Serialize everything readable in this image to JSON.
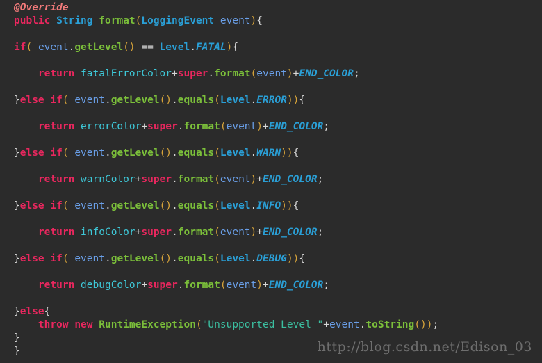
{
  "editor": {
    "background_color": "#2b2b2b",
    "language": "Java",
    "palette": {
      "keyword": "#e8275e",
      "annotation": "#f07a7a",
      "type": "#2a9fd6",
      "constant": "#2a9fd6",
      "method": "#7bbf3a",
      "variable": "#6a9fe8",
      "field": "#3ec8d8",
      "string": "#3bbfa0",
      "paren": "#d6a33a",
      "punctuation": "#d8d8d8"
    }
  },
  "code": {
    "lines": [
      {
        "indent": 0,
        "tokens": [
          {
            "t": "@Override",
            "c": "ann"
          }
        ]
      },
      {
        "indent": 0,
        "tokens": [
          {
            "t": "public",
            "c": "kw"
          },
          {
            "t": " ",
            "c": "pun"
          },
          {
            "t": "String",
            "c": "type"
          },
          {
            "t": " ",
            "c": "pun"
          },
          {
            "t": "format",
            "c": "mth"
          },
          {
            "t": "(",
            "c": "par"
          },
          {
            "t": "LoggingEvent",
            "c": "type"
          },
          {
            "t": " ",
            "c": "pun"
          },
          {
            "t": "event",
            "c": "var"
          },
          {
            "t": ")",
            "c": "par"
          },
          {
            "t": "{",
            "c": "brc"
          }
        ]
      },
      {
        "blank": true
      },
      {
        "indent": 0,
        "tokens": [
          {
            "t": "if",
            "c": "kw"
          },
          {
            "t": "(",
            "c": "par"
          },
          {
            "t": " ",
            "c": "pun"
          },
          {
            "t": "event",
            "c": "var"
          },
          {
            "t": ".",
            "c": "pun"
          },
          {
            "t": "getLevel",
            "c": "mth"
          },
          {
            "t": "()",
            "c": "par"
          },
          {
            "t": " == ",
            "c": "pun"
          },
          {
            "t": "Level",
            "c": "type"
          },
          {
            "t": ".",
            "c": "pun"
          },
          {
            "t": "FATAL",
            "c": "const"
          },
          {
            "t": ")",
            "c": "par"
          },
          {
            "t": "{",
            "c": "brc"
          }
        ]
      },
      {
        "blank": true
      },
      {
        "indent": 1,
        "tokens": [
          {
            "t": "return",
            "c": "kw"
          },
          {
            "t": " ",
            "c": "pun"
          },
          {
            "t": "fatalErrorColor",
            "c": "fld"
          },
          {
            "t": "+",
            "c": "pun"
          },
          {
            "t": "super",
            "c": "kw"
          },
          {
            "t": ".",
            "c": "pun"
          },
          {
            "t": "format",
            "c": "mth"
          },
          {
            "t": "(",
            "c": "par"
          },
          {
            "t": "event",
            "c": "var"
          },
          {
            "t": ")",
            "c": "par"
          },
          {
            "t": "+",
            "c": "pun"
          },
          {
            "t": "END_COLOR",
            "c": "const"
          },
          {
            "t": ";",
            "c": "pun"
          }
        ]
      },
      {
        "blank": true
      },
      {
        "indent": 0,
        "tokens": [
          {
            "t": "}",
            "c": "brc"
          },
          {
            "t": "else",
            "c": "kw"
          },
          {
            "t": " ",
            "c": "pun"
          },
          {
            "t": "if",
            "c": "kw"
          },
          {
            "t": "(",
            "c": "par"
          },
          {
            "t": " ",
            "c": "pun"
          },
          {
            "t": "event",
            "c": "var"
          },
          {
            "t": ".",
            "c": "pun"
          },
          {
            "t": "getLevel",
            "c": "mth"
          },
          {
            "t": "()",
            "c": "par"
          },
          {
            "t": ".",
            "c": "pun"
          },
          {
            "t": "equals",
            "c": "mth"
          },
          {
            "t": "(",
            "c": "par"
          },
          {
            "t": "Level",
            "c": "type"
          },
          {
            "t": ".",
            "c": "pun"
          },
          {
            "t": "ERROR",
            "c": "const"
          },
          {
            "t": "))",
            "c": "par"
          },
          {
            "t": "{",
            "c": "brc"
          }
        ]
      },
      {
        "blank": true
      },
      {
        "indent": 1,
        "tokens": [
          {
            "t": "return",
            "c": "kw"
          },
          {
            "t": " ",
            "c": "pun"
          },
          {
            "t": "errorColor",
            "c": "fld"
          },
          {
            "t": "+",
            "c": "pun"
          },
          {
            "t": "super",
            "c": "kw"
          },
          {
            "t": ".",
            "c": "pun"
          },
          {
            "t": "format",
            "c": "mth"
          },
          {
            "t": "(",
            "c": "par"
          },
          {
            "t": "event",
            "c": "var"
          },
          {
            "t": ")",
            "c": "par"
          },
          {
            "t": "+",
            "c": "pun"
          },
          {
            "t": "END_COLOR",
            "c": "const"
          },
          {
            "t": ";",
            "c": "pun"
          }
        ]
      },
      {
        "blank": true
      },
      {
        "indent": 0,
        "tokens": [
          {
            "t": "}",
            "c": "brc"
          },
          {
            "t": "else",
            "c": "kw"
          },
          {
            "t": " ",
            "c": "pun"
          },
          {
            "t": "if",
            "c": "kw"
          },
          {
            "t": "(",
            "c": "par"
          },
          {
            "t": " ",
            "c": "pun"
          },
          {
            "t": "event",
            "c": "var"
          },
          {
            "t": ".",
            "c": "pun"
          },
          {
            "t": "getLevel",
            "c": "mth"
          },
          {
            "t": "()",
            "c": "par"
          },
          {
            "t": ".",
            "c": "pun"
          },
          {
            "t": "equals",
            "c": "mth"
          },
          {
            "t": "(",
            "c": "par"
          },
          {
            "t": "Level",
            "c": "type"
          },
          {
            "t": ".",
            "c": "pun"
          },
          {
            "t": "WARN",
            "c": "const"
          },
          {
            "t": "))",
            "c": "par"
          },
          {
            "t": "{",
            "c": "brc"
          }
        ]
      },
      {
        "blank": true
      },
      {
        "indent": 1,
        "tokens": [
          {
            "t": "return",
            "c": "kw"
          },
          {
            "t": " ",
            "c": "pun"
          },
          {
            "t": "warnColor",
            "c": "fld"
          },
          {
            "t": "+",
            "c": "pun"
          },
          {
            "t": "super",
            "c": "kw"
          },
          {
            "t": ".",
            "c": "pun"
          },
          {
            "t": "format",
            "c": "mth"
          },
          {
            "t": "(",
            "c": "par"
          },
          {
            "t": "event",
            "c": "var"
          },
          {
            "t": ")",
            "c": "par"
          },
          {
            "t": "+",
            "c": "pun"
          },
          {
            "t": "END_COLOR",
            "c": "const"
          },
          {
            "t": ";",
            "c": "pun"
          }
        ]
      },
      {
        "blank": true
      },
      {
        "indent": 0,
        "tokens": [
          {
            "t": "}",
            "c": "brc"
          },
          {
            "t": "else",
            "c": "kw"
          },
          {
            "t": " ",
            "c": "pun"
          },
          {
            "t": "if",
            "c": "kw"
          },
          {
            "t": "(",
            "c": "par"
          },
          {
            "t": " ",
            "c": "pun"
          },
          {
            "t": "event",
            "c": "var"
          },
          {
            "t": ".",
            "c": "pun"
          },
          {
            "t": "getLevel",
            "c": "mth"
          },
          {
            "t": "()",
            "c": "par"
          },
          {
            "t": ".",
            "c": "pun"
          },
          {
            "t": "equals",
            "c": "mth"
          },
          {
            "t": "(",
            "c": "par"
          },
          {
            "t": "Level",
            "c": "type"
          },
          {
            "t": ".",
            "c": "pun"
          },
          {
            "t": "INFO",
            "c": "const"
          },
          {
            "t": "))",
            "c": "par"
          },
          {
            "t": "{",
            "c": "brc"
          }
        ]
      },
      {
        "blank": true
      },
      {
        "indent": 1,
        "tokens": [
          {
            "t": "return",
            "c": "kw"
          },
          {
            "t": " ",
            "c": "pun"
          },
          {
            "t": "infoColor",
            "c": "fld"
          },
          {
            "t": "+",
            "c": "pun"
          },
          {
            "t": "super",
            "c": "kw"
          },
          {
            "t": ".",
            "c": "pun"
          },
          {
            "t": "format",
            "c": "mth"
          },
          {
            "t": "(",
            "c": "par"
          },
          {
            "t": "event",
            "c": "var"
          },
          {
            "t": ")",
            "c": "par"
          },
          {
            "t": "+",
            "c": "pun"
          },
          {
            "t": "END_COLOR",
            "c": "const"
          },
          {
            "t": ";",
            "c": "pun"
          }
        ]
      },
      {
        "blank": true
      },
      {
        "indent": 0,
        "tokens": [
          {
            "t": "}",
            "c": "brc"
          },
          {
            "t": "else",
            "c": "kw"
          },
          {
            "t": " ",
            "c": "pun"
          },
          {
            "t": "if",
            "c": "kw"
          },
          {
            "t": "(",
            "c": "par"
          },
          {
            "t": " ",
            "c": "pun"
          },
          {
            "t": "event",
            "c": "var"
          },
          {
            "t": ".",
            "c": "pun"
          },
          {
            "t": "getLevel",
            "c": "mth"
          },
          {
            "t": "()",
            "c": "par"
          },
          {
            "t": ".",
            "c": "pun"
          },
          {
            "t": "equals",
            "c": "mth"
          },
          {
            "t": "(",
            "c": "par"
          },
          {
            "t": "Level",
            "c": "type"
          },
          {
            "t": ".",
            "c": "pun"
          },
          {
            "t": "DEBUG",
            "c": "const"
          },
          {
            "t": "))",
            "c": "par"
          },
          {
            "t": "{",
            "c": "brc"
          }
        ]
      },
      {
        "blank": true
      },
      {
        "indent": 1,
        "tokens": [
          {
            "t": "return",
            "c": "kw"
          },
          {
            "t": " ",
            "c": "pun"
          },
          {
            "t": "debugColor",
            "c": "fld"
          },
          {
            "t": "+",
            "c": "pun"
          },
          {
            "t": "super",
            "c": "kw"
          },
          {
            "t": ".",
            "c": "pun"
          },
          {
            "t": "format",
            "c": "mth"
          },
          {
            "t": "(",
            "c": "par"
          },
          {
            "t": "event",
            "c": "var"
          },
          {
            "t": ")",
            "c": "par"
          },
          {
            "t": "+",
            "c": "pun"
          },
          {
            "t": "END_COLOR",
            "c": "const"
          },
          {
            "t": ";",
            "c": "pun"
          }
        ]
      },
      {
        "blank": true
      },
      {
        "indent": 0,
        "tokens": [
          {
            "t": "}",
            "c": "brc"
          },
          {
            "t": "else",
            "c": "kw"
          },
          {
            "t": "{",
            "c": "brc"
          }
        ]
      },
      {
        "indent": 1,
        "tokens": [
          {
            "t": "throw",
            "c": "kw"
          },
          {
            "t": " ",
            "c": "pun"
          },
          {
            "t": "new",
            "c": "kw"
          },
          {
            "t": " ",
            "c": "pun"
          },
          {
            "t": "RuntimeException",
            "c": "mth"
          },
          {
            "t": "(",
            "c": "par"
          },
          {
            "t": "\"Unsupported Level \"",
            "c": "str"
          },
          {
            "t": "+",
            "c": "pun"
          },
          {
            "t": "event",
            "c": "var"
          },
          {
            "t": ".",
            "c": "pun"
          },
          {
            "t": "toString",
            "c": "mth"
          },
          {
            "t": "())",
            "c": "par"
          },
          {
            "t": ";",
            "c": "pun"
          }
        ]
      },
      {
        "indent": 0,
        "tokens": [
          {
            "t": "}",
            "c": "brc"
          }
        ]
      },
      {
        "indent": 0,
        "tokens": [
          {
            "t": "}",
            "c": "brc"
          }
        ]
      }
    ]
  },
  "watermark": {
    "text": "http://blog.csdn.net/Edison_03"
  }
}
